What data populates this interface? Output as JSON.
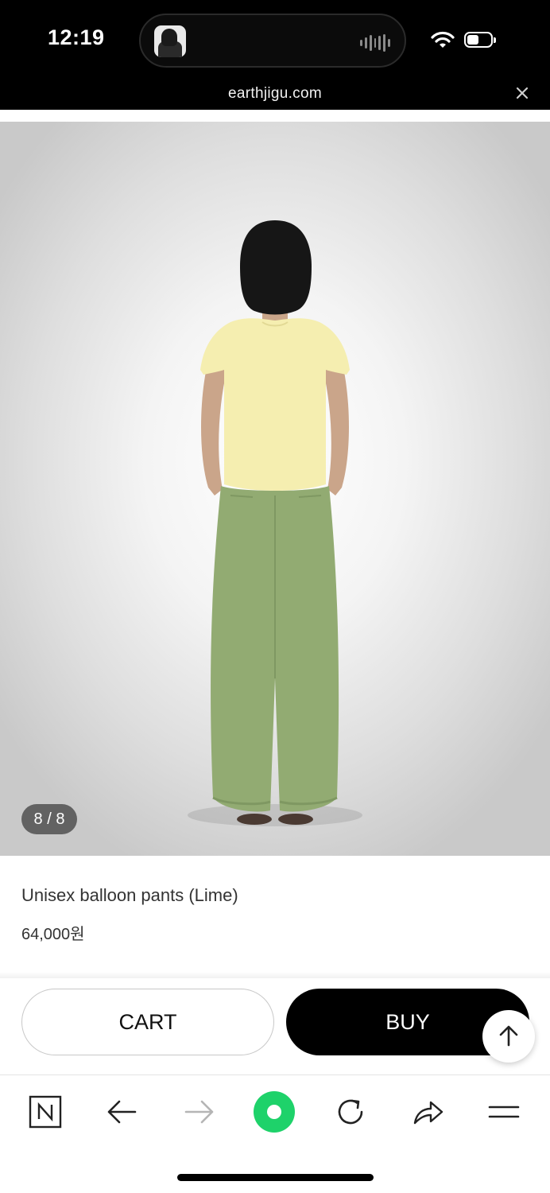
{
  "status_bar": {
    "time": "12:19",
    "url": "earthjigu.com"
  },
  "gallery": {
    "counter": "8 / 8"
  },
  "product": {
    "name": "Unisex balloon pants (Lime)",
    "price": "64,000원"
  },
  "actions": {
    "cart_label": "CART",
    "buy_label": "BUY"
  },
  "toolbar": {
    "icons": [
      "naver-n-icon",
      "back-arrow-icon",
      "forward-arrow-icon",
      "green-home-icon",
      "refresh-icon",
      "share-icon",
      "menu-icon"
    ]
  },
  "colors": {
    "status_bar_bg": "#000000",
    "buy_bg": "#000000",
    "accent_green": "#1ed26a",
    "pants_green": "#92ab72",
    "shirt_yellow": "#f5eeb0"
  }
}
